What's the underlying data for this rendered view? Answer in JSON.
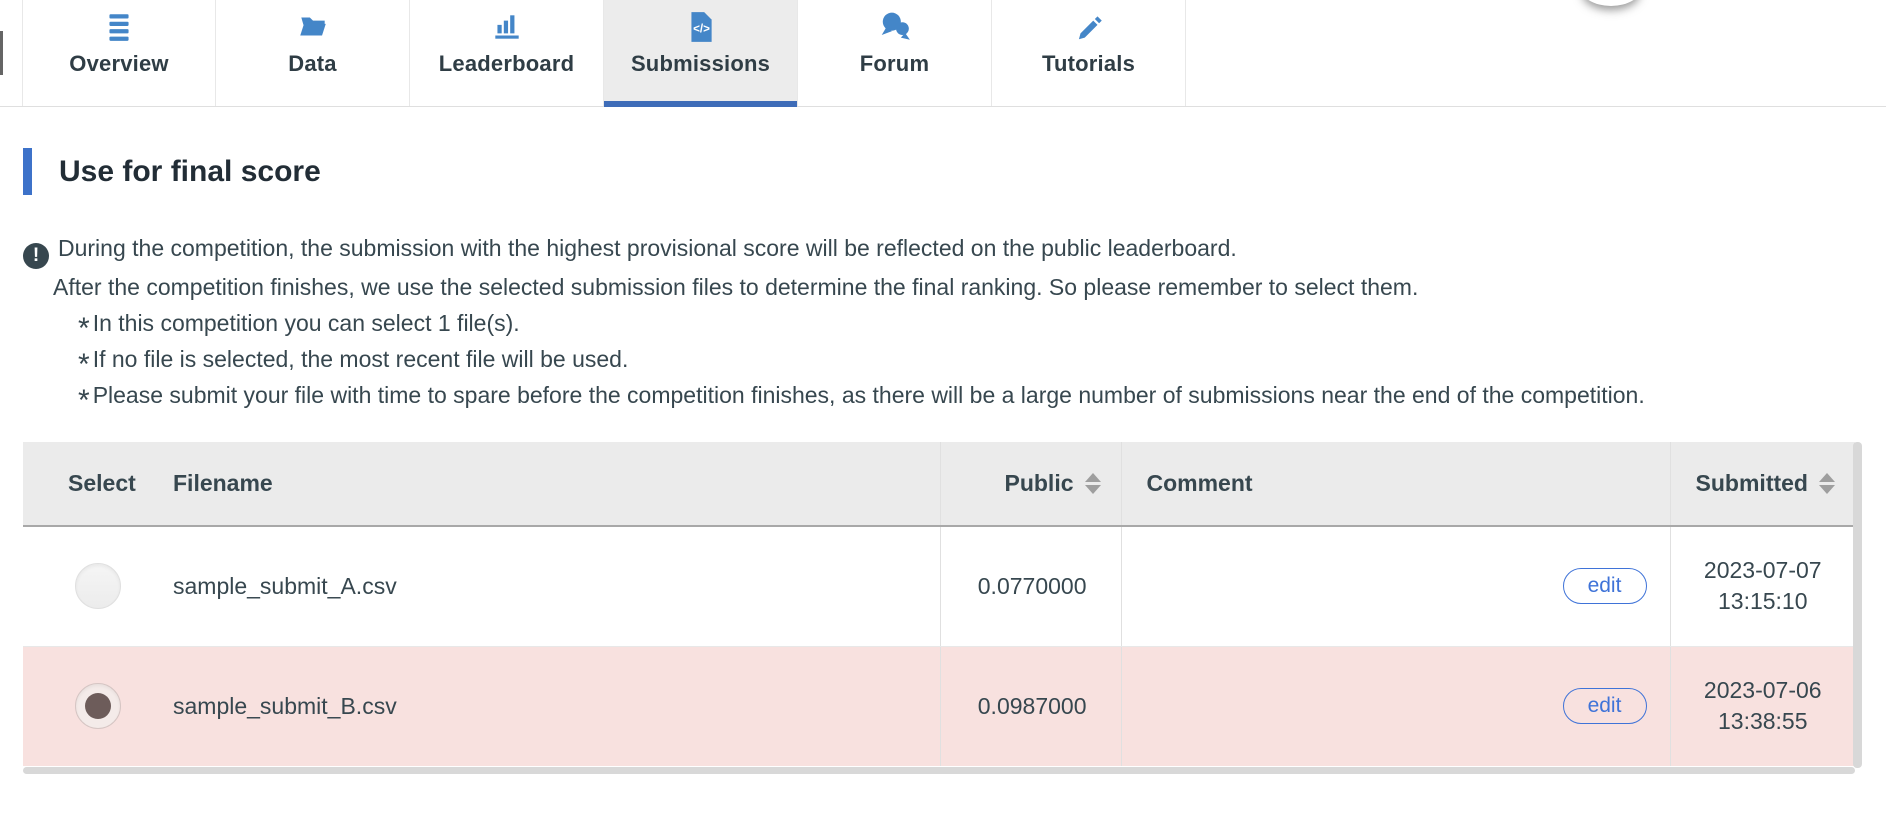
{
  "tabs": [
    {
      "label": "Overview",
      "icon": "list-icon",
      "active": false
    },
    {
      "label": "Data",
      "icon": "folder-icon",
      "active": false
    },
    {
      "label": "Leaderboard",
      "icon": "bar-chart-icon",
      "active": false
    },
    {
      "label": "Submissions",
      "icon": "code-file-icon",
      "active": true
    },
    {
      "label": "Forum",
      "icon": "chat-icon",
      "active": false
    },
    {
      "label": "Tutorials",
      "icon": "pencil-icon",
      "active": false
    }
  ],
  "section": {
    "title": "Use for final score"
  },
  "notice": {
    "alert_icon_char": "!",
    "line1": "During the competition, the submission with the highest provisional score will be reflected on the public leaderboard.",
    "line2": "After the competition finishes, we use the selected submission files to determine the final ranking. So please remember to select them.",
    "bullet_prefix": "*",
    "bullets": [
      "In this competition you can select 1 file(s).",
      "If no file is selected, the most recent file will be used.",
      "Please submit your file with time to spare before the competition finishes, as there will be a large number of submissions near the end of the competition."
    ]
  },
  "table": {
    "columns": [
      {
        "label": "Select",
        "sortable": false
      },
      {
        "label": "Filename",
        "sortable": false
      },
      {
        "label": "Public",
        "sortable": true
      },
      {
        "label": "Comment",
        "sortable": false
      },
      {
        "label": "Submitted",
        "sortable": true
      }
    ],
    "rows": [
      {
        "selected": false,
        "filename": "sample_submit_A.csv",
        "public": "0.0770000",
        "comment": "",
        "edit_label": "edit",
        "submitted_date": "2023-07-07",
        "submitted_time": "13:15:10"
      },
      {
        "selected": true,
        "filename": "sample_submit_B.csv",
        "public": "0.0987000",
        "comment": "",
        "edit_label": "edit",
        "submitted_date": "2023-07-06",
        "submitted_time": "13:38:55"
      }
    ]
  },
  "colors": {
    "accent_blue": "#3e6cb8",
    "icon_blue": "#4486c8",
    "link_blue": "#3f73d8",
    "selected_row_bg": "#f8e1df",
    "table_header_bg": "#ebebeb",
    "active_tab_bg": "#ececec",
    "text_dark": "#37474f",
    "sort_gray": "#9e9e9e",
    "radio_dot": "#6d5c5a"
  }
}
